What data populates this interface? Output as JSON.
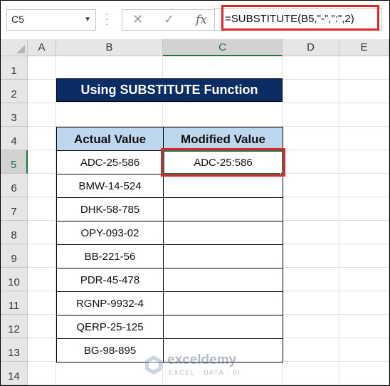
{
  "name_box": {
    "value": "C5"
  },
  "formula_bar": {
    "cancel_icon": "cross-icon",
    "enter_icon": "check-icon",
    "function_icon": "fx-icon",
    "fx_label": "fx",
    "formula": "=SUBSTITUTE(B5,\"-\",\":\",2)"
  },
  "columns": [
    "A",
    "B",
    "C",
    "D",
    "E"
  ],
  "selected_column": "C",
  "rows": [
    "1",
    "2",
    "3",
    "4",
    "5",
    "6",
    "7",
    "8",
    "9",
    "10",
    "11",
    "12",
    "13",
    "14"
  ],
  "selected_row": "5",
  "title": "Using SUBSTITUTE Function",
  "table": {
    "headers": [
      "Actual Value",
      "Modified Value"
    ],
    "rows": [
      [
        "ADC-25-586",
        "ADC-25:586"
      ],
      [
        "BMW-14-524",
        ""
      ],
      [
        "DHK-58-785",
        ""
      ],
      [
        "OPY-093-02",
        ""
      ],
      [
        "BB-221-56",
        ""
      ],
      [
        "PDR-45-478",
        ""
      ],
      [
        "RGNP-9932-4",
        ""
      ],
      [
        "QERP-25-125",
        ""
      ],
      [
        "BG-98-895",
        ""
      ]
    ]
  },
  "watermark": {
    "name": "exceldemy",
    "tagline": "EXCEL · DATA · BI"
  },
  "colors": {
    "accent_green": "#217346",
    "highlight_red": "#e0252b",
    "title_bg": "#0c2c66",
    "header_bg": "#bdd7ee"
  }
}
